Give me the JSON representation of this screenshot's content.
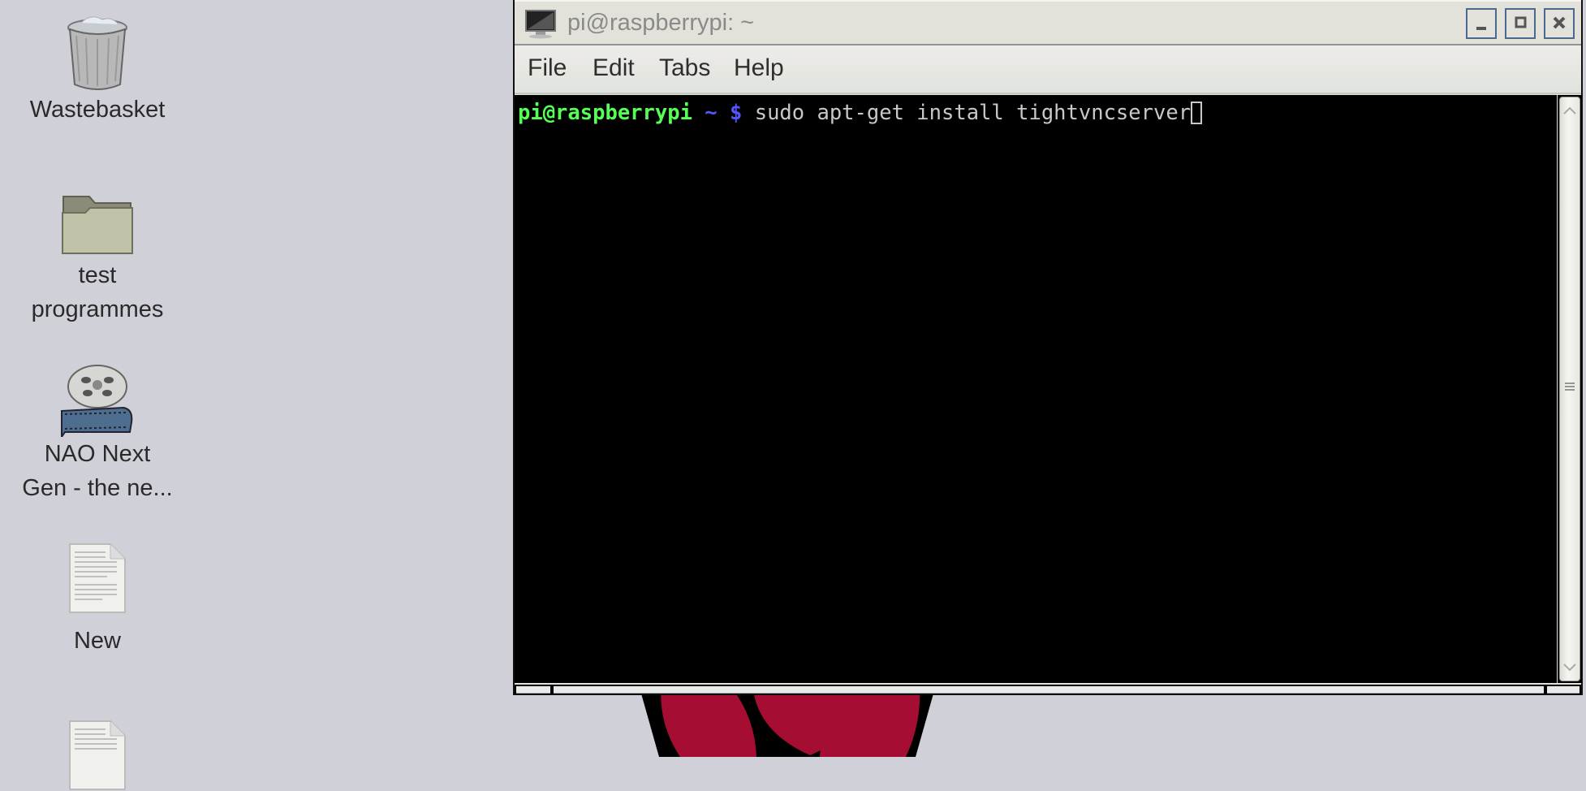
{
  "desktop": {
    "background_color": "#d0d0d8",
    "icons": [
      {
        "name": "wastebasket",
        "label_line1": "Wastebasket",
        "label_line2": "",
        "icon": "trash-icon"
      },
      {
        "name": "folder",
        "label_line1": "test",
        "label_line2": "programmes",
        "icon": "folder-icon"
      },
      {
        "name": "video",
        "label_line1": "NAO Next",
        "label_line2": "Gen - the ne...",
        "icon": "film-reel-icon"
      },
      {
        "name": "document",
        "label_line1": "New",
        "label_line2": "",
        "icon": "document-icon"
      },
      {
        "name": "document-2",
        "label_line1": "",
        "label_line2": "",
        "icon": "document-icon"
      }
    ],
    "wallpaper_logo": {
      "icon": "raspberry-logo-icon",
      "color": "#a50d32"
    }
  },
  "window": {
    "title": "pi@raspberrypi: ~",
    "buttons": {
      "minimize": "minimize",
      "maximize": "maximize",
      "close": "close"
    },
    "menu": [
      "File",
      "Edit",
      "Tabs",
      "Help"
    ],
    "terminal": {
      "user_host": "pi@raspberrypi",
      "cwd": " ~ ",
      "prompt_symbol": "$",
      "command": " sudo apt-get install tightvncserver",
      "colors": {
        "user": "#55ff55",
        "prompt": "#5555ff",
        "text": "#c8c8c8",
        "background": "#000000"
      }
    }
  }
}
